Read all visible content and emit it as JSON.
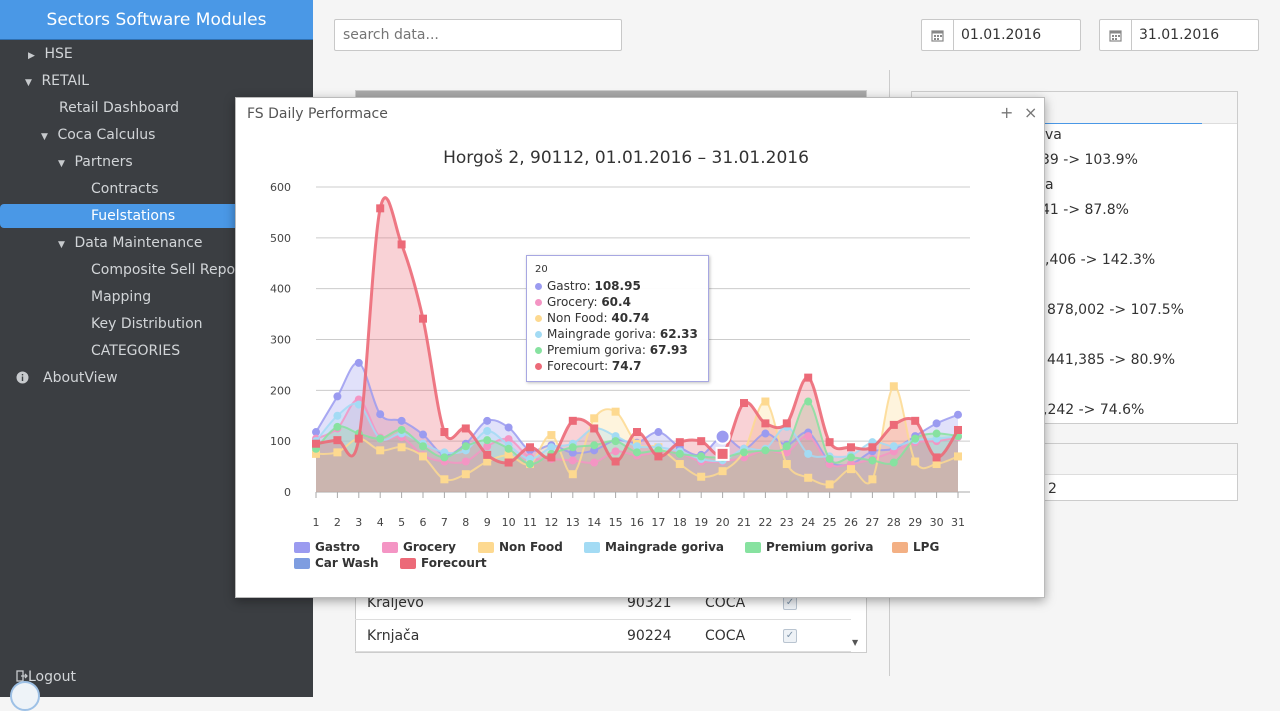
{
  "sidebar": {
    "title": "Sectors Software Modules",
    "items": [
      {
        "label": "HSE",
        "arrow": "▶"
      },
      {
        "label": "RETAIL",
        "arrow": "▼"
      },
      {
        "label": "Retail Dashboard",
        "arrow": ""
      },
      {
        "label": "Coca Calculus",
        "arrow": "▼"
      },
      {
        "label": "Partners",
        "arrow": "▼"
      },
      {
        "label": "Contracts",
        "arrow": ""
      },
      {
        "label": "Fuelstations",
        "arrow": ""
      },
      {
        "label": "Data Maintenance",
        "arrow": "▼"
      },
      {
        "label": "Composite Sell Report",
        "arrow": ""
      },
      {
        "label": "Mapping",
        "arrow": ""
      },
      {
        "label": "Key Distribution",
        "arrow": ""
      },
      {
        "label": "CATEGORIES",
        "arrow": ""
      },
      {
        "label": "AboutView",
        "arrow": ""
      }
    ],
    "logout": "Logout"
  },
  "toolbar": {
    "search_placeholder": "search data...",
    "date_from": "01.01.2016",
    "date_to": "31.01.2016"
  },
  "table": {
    "rows": [
      {
        "name": "Kraljevo",
        "code": "90321",
        "type": "COCA",
        "checked": true
      },
      {
        "name": "Krnjača",
        "code": "90224",
        "type": "COCA",
        "checked": true
      }
    ]
  },
  "right_panel": {
    "lines": [
      "va",
      "39 -> 103.9%",
      "a",
      "41 -> 87.8%",
      ",406 -> 142.3%",
      "878,002 -> 107.5%",
      "441,385 -> 80.9%",
      ",242 -> 74.6%"
    ],
    "second": "2"
  },
  "modal": {
    "title": "FS Daily Performace",
    "plus_icon": "+",
    "close_icon": "×"
  },
  "colors": {
    "accent": "#4a98e6",
    "gastro": "#9b9bf0",
    "grocery": "#f495c4",
    "non_food": "#fdd990",
    "maingrade": "#a3dbf4",
    "premium": "#87e2a0",
    "lpg": "#f3b084",
    "car_wash": "#7e9de0",
    "forecourt": "#ec6a78"
  },
  "tooltip": {
    "header": "20",
    "entries": [
      {
        "name": "Gastro",
        "value": "108.95",
        "color": "#9b9bf0"
      },
      {
        "name": "Grocery",
        "value": "60.4",
        "color": "#f495c4"
      },
      {
        "name": "Non Food",
        "value": "40.74",
        "color": "#fdd990"
      },
      {
        "name": "Maingrade goriva",
        "value": "62.33",
        "color": "#a3dbf4"
      },
      {
        "name": "Premium goriva",
        "value": "67.93",
        "color": "#87e2a0"
      },
      {
        "name": "Forecourt",
        "value": "74.7",
        "color": "#ec6a78"
      }
    ]
  },
  "chart_data": {
    "type": "area",
    "title": "Horgoš 2, 90112, 01.01.2016 – 31.01.2016",
    "x": [
      1,
      2,
      3,
      4,
      5,
      6,
      7,
      8,
      9,
      10,
      11,
      12,
      13,
      14,
      15,
      16,
      17,
      18,
      19,
      20,
      21,
      22,
      23,
      24,
      25,
      26,
      27,
      28,
      29,
      30,
      31
    ],
    "ylim": [
      0,
      600
    ],
    "yticks": [
      0,
      100,
      200,
      300,
      400,
      500,
      600
    ],
    "grid": true,
    "legend_position": "bottom",
    "series": [
      {
        "name": "Gastro",
        "color": "#9b9bf0",
        "marker": "circle",
        "values": [
          118,
          188,
          254,
          153,
          140,
          113,
          73,
          95,
          140,
          127,
          82,
          92,
          77,
          82,
          102,
          97,
          118,
          88,
          73,
          109,
          85,
          115,
          93,
          117,
          60,
          55,
          80,
          85,
          110,
          135,
          152
        ]
      },
      {
        "name": "Grocery",
        "color": "#f495c4",
        "marker": "circle",
        "values": [
          105,
          125,
          182,
          107,
          108,
          72,
          60,
          60,
          90,
          104,
          68,
          65,
          62,
          58,
          80,
          72,
          78,
          76,
          60,
          60,
          68,
          82,
          78,
          110,
          55,
          55,
          65,
          80,
          98,
          100,
          108
        ]
      },
      {
        "name": "Non Food",
        "color": "#fdd990",
        "marker": "square",
        "values": [
          75,
          78,
          105,
          82,
          88,
          70,
          25,
          35,
          60,
          72,
          55,
          112,
          35,
          145,
          158,
          95,
          88,
          55,
          30,
          41,
          80,
          178,
          55,
          28,
          15,
          45,
          25,
          208,
          60,
          55,
          70
        ]
      },
      {
        "name": "Maingrade goriva",
        "color": "#a3dbf4",
        "marker": "circle",
        "values": [
          100,
          150,
          172,
          105,
          115,
          95,
          78,
          82,
          120,
          92,
          65,
          88,
          95,
          125,
          110,
          90,
          88,
          80,
          65,
          62,
          85,
          85,
          128,
          75,
          70,
          72,
          98,
          90,
          102,
          105,
          110
        ]
      },
      {
        "name": "Premium goriva",
        "color": "#87e2a0",
        "marker": "circle",
        "values": [
          85,
          128,
          115,
          105,
          122,
          90,
          68,
          90,
          102,
          85,
          55,
          75,
          88,
          92,
          100,
          78,
          82,
          75,
          70,
          68,
          78,
          82,
          90,
          178,
          65,
          68,
          62,
          58,
          105,
          115,
          110
        ]
      },
      {
        "name": "LPG",
        "color": "#f3b084",
        "marker": "circle",
        "values": []
      },
      {
        "name": "Car Wash",
        "color": "#7e9de0",
        "marker": "circle",
        "values": []
      },
      {
        "name": "Forecourt",
        "color": "#ec6a78",
        "marker": "square",
        "values": [
          95,
          102,
          105,
          558,
          487,
          341,
          118,
          125,
          73,
          58,
          88,
          68,
          140,
          125,
          60,
          118,
          70,
          98,
          100,
          75,
          175,
          135,
          135,
          225,
          98,
          88,
          88,
          132,
          140,
          68,
          122
        ]
      }
    ]
  }
}
